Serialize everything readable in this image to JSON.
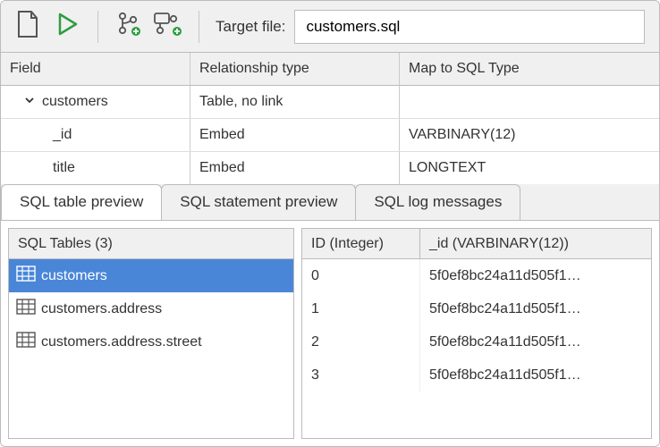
{
  "toolbar": {
    "target_label": "Target file:",
    "target_value": "customers.sql",
    "icons": {
      "new_file": "new-file-icon",
      "run": "run-icon",
      "branch_add": "branch-add-icon",
      "branch_link_add": "branch-link-add-icon"
    }
  },
  "schema": {
    "headers": {
      "field": "Field",
      "rel": "Relationship type",
      "map": "Map to SQL Type"
    },
    "rows": [
      {
        "field": "customers",
        "rel": "Table, no link",
        "map": "",
        "level": 1,
        "expandable": true
      },
      {
        "field": "_id",
        "rel": "Embed",
        "map": "VARBINARY(12)",
        "level": 2,
        "expandable": false
      },
      {
        "field": "title",
        "rel": "Embed",
        "map": "LONGTEXT",
        "level": 2,
        "expandable": false
      }
    ]
  },
  "tabs": [
    "SQL table preview",
    "SQL statement preview",
    "SQL log messages"
  ],
  "active_tab": 0,
  "left_panel": {
    "header": "SQL Tables (3)",
    "items": [
      "customers",
      "customers.address",
      "customers.address.street"
    ],
    "selected": 0
  },
  "right_panel": {
    "headers": [
      "ID (Integer)",
      "_id (VARBINARY(12))"
    ],
    "rows": [
      [
        "0",
        "5f0ef8bc24a11d505f1…"
      ],
      [
        "1",
        "5f0ef8bc24a11d505f1…"
      ],
      [
        "2",
        "5f0ef8bc24a11d505f1…"
      ],
      [
        "3",
        "5f0ef8bc24a11d505f1…"
      ]
    ]
  }
}
